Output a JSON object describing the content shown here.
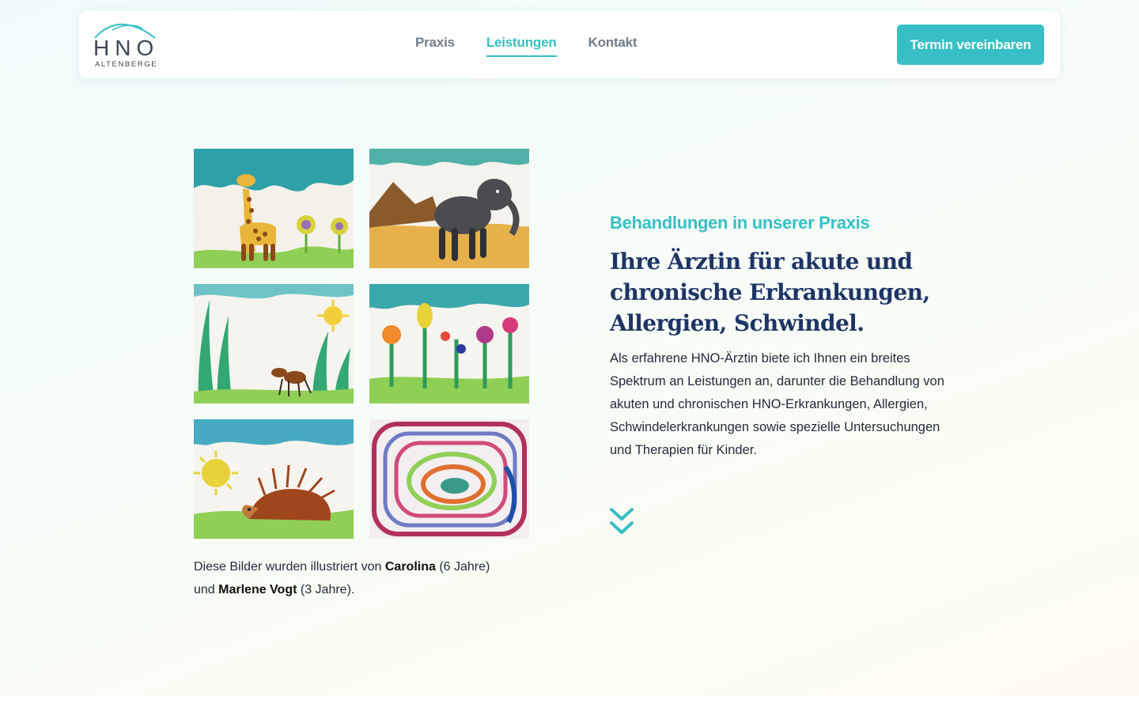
{
  "logo": {
    "main": "HNO",
    "sub": "ALTENBERGE"
  },
  "nav": {
    "items": [
      {
        "label": "Praxis"
      },
      {
        "label": "Leistungen"
      },
      {
        "label": "Kontakt"
      }
    ],
    "active_index": 1
  },
  "cta": {
    "label": "Termin vereinbaren"
  },
  "gallery": {
    "images": [
      {
        "subject": "giraffe-painting"
      },
      {
        "subject": "elephant-painting"
      },
      {
        "subject": "ant-in-grass-painting"
      },
      {
        "subject": "flowers-painting"
      },
      {
        "subject": "hedgehog-painting"
      },
      {
        "subject": "abstract-spiral-painting"
      }
    ],
    "caption": {
      "prefix": "Diese Bilder wurden illustriert von ",
      "artist1": "Carolina",
      "age1": " (6 Jahre)",
      "connector": "und ",
      "artist2": "Marlene Vogt",
      "age2": " (3 Jahre)."
    }
  },
  "hero": {
    "eyebrow": "Behandlungen in unserer Praxis",
    "headline": "Ihre Ärztin für akute und chronische Erkrankungen, Allergien, Schwindel.",
    "body": "Als erfahrene HNO-Ärztin biete ich Ihnen ein breites Spektrum an Leistungen an, darunter die Behandlung von akuten und chronischen HNO-Erkrankungen, Allergien, Schwindelerkrankungen sowie spezielle Untersuchungen und Therapien für Kinder."
  },
  "colors": {
    "accent": "#37bfc5",
    "headline": "#1d3565",
    "nav_inactive": "#6f7d8b"
  },
  "icons": {
    "scroll": "double-chevron-down-icon"
  }
}
